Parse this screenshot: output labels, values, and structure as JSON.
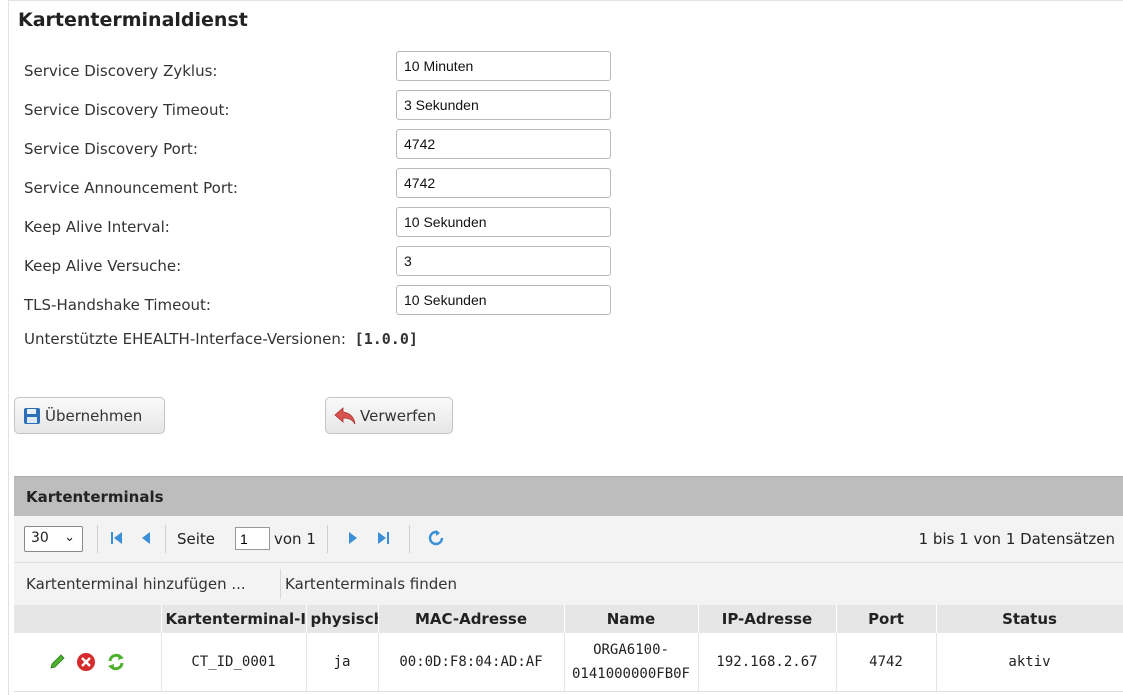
{
  "page": {
    "title": "Kartenterminaldienst"
  },
  "settings": [
    {
      "label": "Service Discovery Zyklus:",
      "value": "10 Minuten"
    },
    {
      "label": "Service Discovery Timeout:",
      "value": "3 Sekunden"
    },
    {
      "label": "Service Discovery Port:",
      "value": "4742"
    },
    {
      "label": "Service Announcement Port:",
      "value": "4742"
    },
    {
      "label": "Keep Alive Interval:",
      "value": "10 Sekunden"
    },
    {
      "label": "Keep Alive Versuche:",
      "value": "3"
    },
    {
      "label": "TLS-Handshake Timeout:",
      "value": "10 Sekunden"
    }
  ],
  "versions": {
    "label": "Unterstützte EHEALTH-Interface-Versionen:",
    "value": "[1.0.0]"
  },
  "buttons": {
    "apply": "Übernehmen",
    "discard": "Verwerfen"
  },
  "grid": {
    "title": "Kartenterminals",
    "pager": {
      "page_size": "30",
      "page_label": "Seite",
      "page_value": "1",
      "of_label": "von 1",
      "records": "1 bis 1 von 1 Datensätzen"
    },
    "toolbar": {
      "add": "Kartenterminal hinzufügen ...",
      "find": "Kartenterminals finden"
    },
    "columns": [
      "",
      "Kartenterminal-ID",
      "physisch",
      "MAC-Adresse",
      "Name",
      "IP-Adresse",
      "Port",
      "Status"
    ],
    "rows": [
      {
        "id": "CT_ID_0001",
        "physical": "ja",
        "mac": "00:0D:F8:04:AD:AF",
        "name_line1": "ORGA6100-",
        "name_line2": "0141000000FB0F",
        "ip": "192.168.2.67",
        "port": "4742",
        "status": "aktiv"
      }
    ]
  },
  "icons": {
    "apply": "floppy-disk-icon",
    "discard": "undo-arrow-icon",
    "edit": "pencil-icon",
    "delete": "red-x-icon",
    "refresh": "green-refresh-icon"
  },
  "colors": {
    "header_bg": "#bdbdbd",
    "pager_bg": "#f3f3f3",
    "accent_blue": "#3a8fd8"
  }
}
